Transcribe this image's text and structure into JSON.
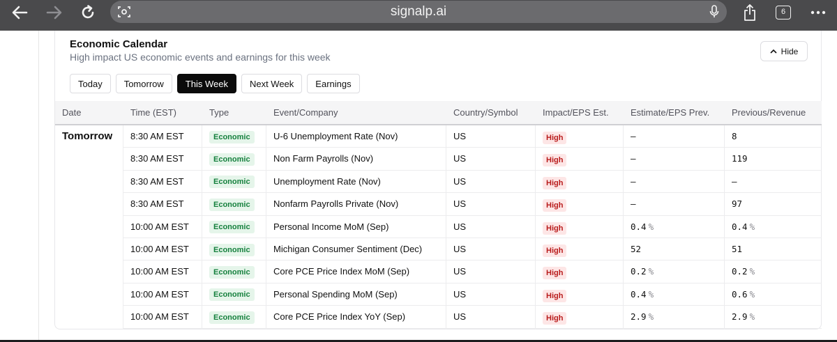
{
  "browser": {
    "url": "signalp.ai",
    "tab_count": "6"
  },
  "calendar": {
    "title": "Economic Calendar",
    "subtitle": "High impact US economic events and earnings for this week",
    "hide_label": "Hide",
    "tabs": [
      {
        "label": "Today",
        "active": false
      },
      {
        "label": "Tomorrow",
        "active": false
      },
      {
        "label": "This Week",
        "active": true
      },
      {
        "label": "Next Week",
        "active": false
      },
      {
        "label": "Earnings",
        "active": false
      }
    ],
    "columns": [
      "Date",
      "Time (EST)",
      "Type",
      "Event/Company",
      "Country/Symbol",
      "Impact/EPS Est.",
      "Estimate/EPS Prev.",
      "Previous/Revenue"
    ],
    "date_group": "Tomorrow",
    "rows": [
      {
        "time": "8:30 AM EST",
        "type": "Economic",
        "event": "U-6 Unemployment Rate (Nov)",
        "country": "US",
        "impact": "High",
        "estimate": "–",
        "estimate_pct": "",
        "previous": "8",
        "previous_pct": ""
      },
      {
        "time": "8:30 AM EST",
        "type": "Economic",
        "event": "Non Farm Payrolls (Nov)",
        "country": "US",
        "impact": "High",
        "estimate": "–",
        "estimate_pct": "",
        "previous": "119",
        "previous_pct": ""
      },
      {
        "time": "8:30 AM EST",
        "type": "Economic",
        "event": "Unemployment Rate (Nov)",
        "country": "US",
        "impact": "High",
        "estimate": "–",
        "estimate_pct": "",
        "previous": "–",
        "previous_pct": ""
      },
      {
        "time": "8:30 AM EST",
        "type": "Economic",
        "event": "Nonfarm Payrolls Private (Nov)",
        "country": "US",
        "impact": "High",
        "estimate": "–",
        "estimate_pct": "",
        "previous": "97",
        "previous_pct": ""
      },
      {
        "time": "10:00 AM EST",
        "type": "Economic",
        "event": "Personal Income MoM (Sep)",
        "country": "US",
        "impact": "High",
        "estimate": "0.4",
        "estimate_pct": "%",
        "previous": "0.4",
        "previous_pct": "%"
      },
      {
        "time": "10:00 AM EST",
        "type": "Economic",
        "event": "Michigan Consumer Sentiment (Dec)",
        "country": "US",
        "impact": "High",
        "estimate": "52",
        "estimate_pct": "",
        "previous": "51",
        "previous_pct": ""
      },
      {
        "time": "10:00 AM EST",
        "type": "Economic",
        "event": "Core PCE Price Index MoM (Sep)",
        "country": "US",
        "impact": "High",
        "estimate": "0.2",
        "estimate_pct": "%",
        "previous": "0.2",
        "previous_pct": "%"
      },
      {
        "time": "10:00 AM EST",
        "type": "Economic",
        "event": "Personal Spending MoM (Sep)",
        "country": "US",
        "impact": "High",
        "estimate": "0.4",
        "estimate_pct": "%",
        "previous": "0.6",
        "previous_pct": "%"
      },
      {
        "time": "10:00 AM EST",
        "type": "Economic",
        "event": "Core PCE Price Index YoY (Sep)",
        "country": "US",
        "impact": "High",
        "estimate": "2.9",
        "estimate_pct": "%",
        "previous": "2.9",
        "previous_pct": "%"
      }
    ]
  },
  "colors": {
    "accent_active_tab": "#0b0b0b",
    "economic_badge": "#15803d",
    "high_badge": "#b91c1c"
  },
  "icons": [
    "back-arrow-icon",
    "forward-arrow-icon",
    "reload-icon",
    "page-scan-icon",
    "microphone-icon",
    "share-icon",
    "tabs-icon",
    "more-icon",
    "chevron-up-icon"
  ]
}
